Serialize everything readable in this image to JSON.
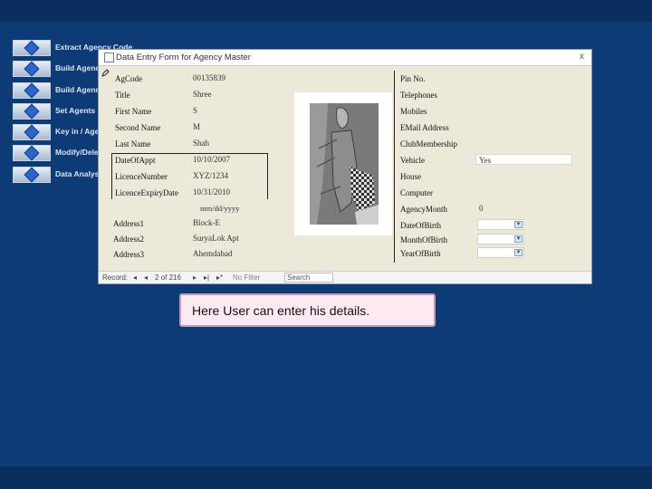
{
  "menu": {
    "items": [
      {
        "label": "Extract Agency Code"
      },
      {
        "label": "Build Agency"
      },
      {
        "label": "Build Agency"
      },
      {
        "label": "Set Agents"
      },
      {
        "label": "Key in / Agents"
      },
      {
        "label": "Modify/Delete"
      },
      {
        "label": "Data Analysis"
      }
    ]
  },
  "window": {
    "title": "Data Entry Form for Agency Master",
    "close": "x"
  },
  "form": {
    "left": [
      {
        "label": "AgCode",
        "value": "00135839"
      },
      {
        "label": "Title",
        "value": "Shree"
      },
      {
        "label": "First Name",
        "value": "S"
      },
      {
        "label": "Second Name",
        "value": "M"
      },
      {
        "label": "Last Name",
        "value": "Shah"
      },
      {
        "label": "DateOfAppt",
        "value": "10/10/2007"
      },
      {
        "label": "LicenceNumber",
        "value": "XYZ/1234"
      },
      {
        "label": "LicenceExpiryDate",
        "value": "10/31/2010"
      }
    ],
    "date_format_hint": "mm/dd/yyyy",
    "address": [
      {
        "label": "Address1",
        "value": "Block-E"
      },
      {
        "label": "Address2",
        "value": "SuryaLok Apt"
      },
      {
        "label": "Address3",
        "value": "Ahemdabad"
      }
    ],
    "right": [
      {
        "label": "Pin No.",
        "value": ""
      },
      {
        "label": "Telephones",
        "value": ""
      },
      {
        "label": "Mobiles",
        "value": ""
      },
      {
        "label": "EMail Address",
        "value": ""
      },
      {
        "label": "ClubMembership",
        "value": ""
      },
      {
        "label": "Vehicle",
        "value": "Yes"
      },
      {
        "label": "House",
        "value": ""
      },
      {
        "label": "Computer",
        "value": ""
      },
      {
        "label": "AgencyMonth",
        "value": "0"
      },
      {
        "label": "DateOfBirth",
        "value": ""
      },
      {
        "label": "MonthOfBirth",
        "value": ""
      },
      {
        "label": "YearOfBirth",
        "value": ""
      }
    ]
  },
  "record_nav": {
    "label": "Record:",
    "first": "◂",
    "prev": "◂",
    "position": "2 of 216",
    "next": "▸",
    "last": "▸|",
    "new": "▸*",
    "filter": "No Filter",
    "search": "Search"
  },
  "callout": {
    "text": "Here User can enter his details."
  },
  "colors": {
    "background": "#0d3b75",
    "form_bg": "#ece9d8",
    "callout_bg": "#fde9f2"
  }
}
